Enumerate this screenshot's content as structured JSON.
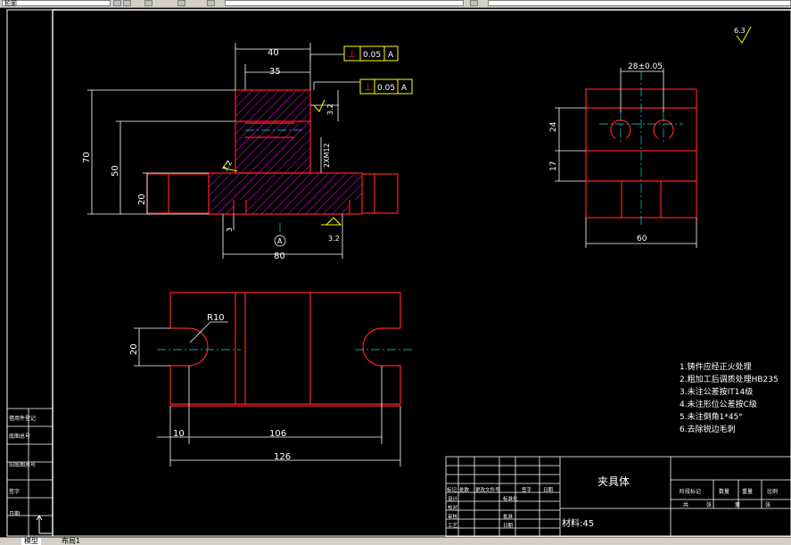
{
  "toolbar": {
    "layer_value": "轮廓",
    "icons": [
      "layer-icon",
      "save-icon",
      "print-icon",
      "pan-icon",
      "zoom-icon",
      "lock-icon",
      "properties-icon"
    ]
  },
  "drawing": {
    "front_view": {
      "dims": {
        "top_width": "40",
        "inner_width": "35",
        "height_total": "70",
        "height_mid": "50",
        "height_base": "20",
        "base_length": "80",
        "hole_dim": "2XM12",
        "small_gap": "3"
      },
      "tolerances": [
        {
          "symbol": "⊥",
          "value": "0.05",
          "datum": "A"
        },
        {
          "symbol": "⊥",
          "value": "0.05",
          "datum": "A"
        }
      ],
      "roughness": [
        "3.2",
        "3.2",
        "3.2"
      ],
      "datum_label": "A"
    },
    "side_view": {
      "dims": {
        "hole_spacing": "28±0.05",
        "upper_height": "24",
        "lower_height": "17",
        "width": "60"
      }
    },
    "top_view": {
      "dims": {
        "radius": "R10",
        "slot_width": "20",
        "slot_offset": "10",
        "inner_length": "106",
        "overall_length": "126"
      }
    },
    "roughness_corner": "6.3",
    "notes": [
      "1.铸件应经正火处理",
      "2.粗加工后调质处理HB235",
      "3.未注公差按IT14级",
      "4.未注形位公差按C级",
      "5.未注倒角1*45°",
      "6.去除锐边毛刺"
    ],
    "left_strip_labels": [
      "借用件登记",
      "底图总号",
      "旧底图总号",
      "签字",
      "日期"
    ],
    "title_block": {
      "part_name": "夹具体",
      "material": "材料:45",
      "header_cells": [
        "标记",
        "处数",
        "更改文件号",
        "签字",
        "日期"
      ],
      "row_labels": [
        "设计",
        "校对",
        "审核",
        "工艺"
      ],
      "mid_labels": [
        "标准化",
        "批准",
        "日期"
      ],
      "right_header": [
        "阶段标记",
        "数量",
        "重量",
        "比例"
      ],
      "right_footer": [
        "共",
        "张",
        "第",
        "张"
      ]
    }
  },
  "tabs": [
    {
      "label": "模型",
      "active": true
    },
    {
      "label": "布局1",
      "active": false
    }
  ]
}
